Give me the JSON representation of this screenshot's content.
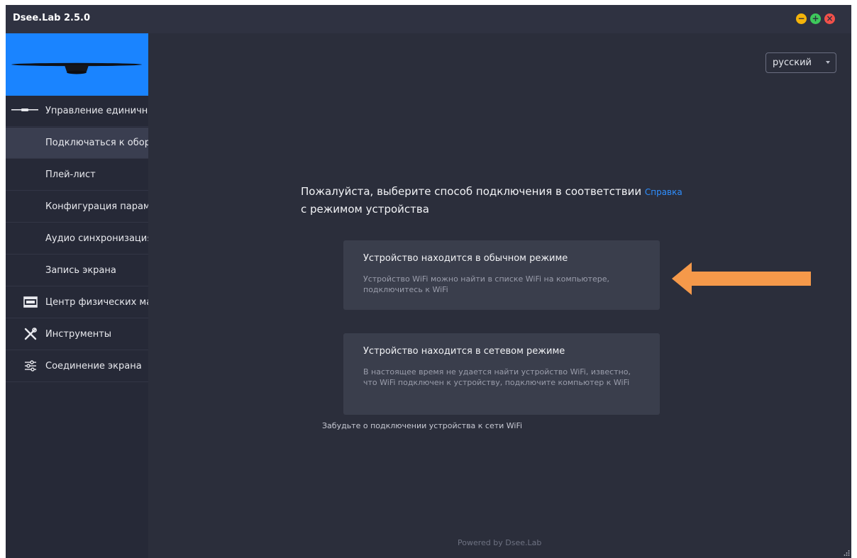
{
  "window": {
    "title": "Dsee.Lab 2.5.0"
  },
  "controls": {
    "minimize": "−",
    "maximize": "+",
    "close": "×"
  },
  "sidebar": {
    "items": [
      {
        "label": "Управление единичной",
        "icon": "single-device-icon"
      },
      {
        "label": "Подключаться к обор",
        "selected": true
      },
      {
        "label": "Плей-лист"
      },
      {
        "label": "Конфигурация параме"
      },
      {
        "label": "Аудио синхронизация"
      },
      {
        "label": "Запись экрана"
      },
      {
        "label": "Центр физических ма",
        "icon": "film-icon"
      },
      {
        "label": "Инструменты",
        "icon": "tools-icon"
      },
      {
        "label": "Соединение экрана",
        "icon": "sliders-icon"
      }
    ]
  },
  "main": {
    "language": "русский",
    "prompt_text": "Пожалуйста, выберите способ подключения в соответствии",
    "prompt_line2": "с режимом устройства",
    "help_link": "Справка",
    "cards": [
      {
        "title": "Устройство находится в обычном режиме",
        "desc": "Устройство WiFi можно найти в списке WiFi на компьютере, подключитесь к WiFi"
      },
      {
        "title": "Устройство находится в сетевом режиме",
        "desc": "В настоящее время не удается найти устройство WiFi, известно, что WiFi подключен к устройству, подключите компьютер к WiFi"
      }
    ],
    "forget_link": "Забудьте о подключении устройства к сети WiFi",
    "footer": "Powered by Dsee.Lab"
  },
  "colors": {
    "background": "#2b2e3b",
    "sidebar": "#262937",
    "banner": "#1a84ff",
    "accent_link": "#2f8fff",
    "arrow": "#f5994a"
  }
}
